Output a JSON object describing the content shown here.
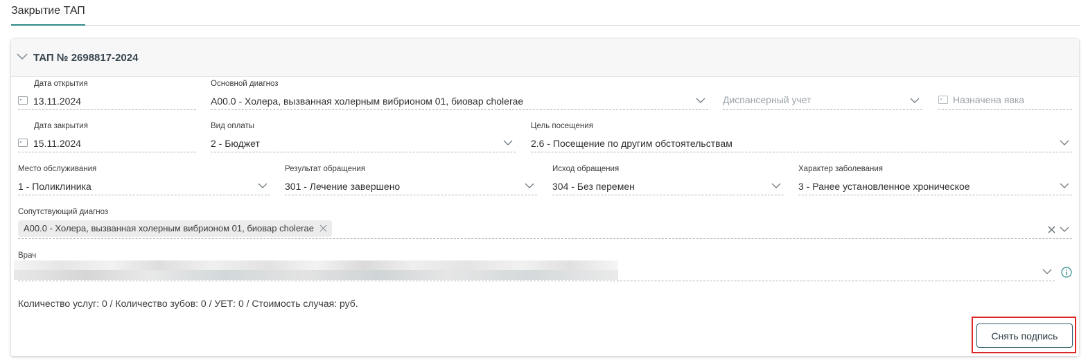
{
  "tabs": {
    "active": "Закрытие ТАП"
  },
  "card": {
    "title": "ТАП № 2698817-2024"
  },
  "fields": {
    "open_date": {
      "label": "Дата открытия",
      "value": "13.11.2024"
    },
    "main_diagnosis": {
      "label": "Основной диагноз",
      "value": "A00.0 - Холера, вызванная холерным вибрионом 01, биовар cholerae"
    },
    "dispensary": {
      "placeholder": "Диспансерный учет"
    },
    "appointment": {
      "placeholder": "Назначена явка"
    },
    "close_date": {
      "label": "Дата закрытия",
      "value": "15.11.2024"
    },
    "payment_type": {
      "label": "Вид оплаты",
      "value": "2 - Бюджет"
    },
    "visit_purpose": {
      "label": "Цель посещения",
      "value": "2.6 - Посещение по другим обстоятельствам"
    },
    "service_place": {
      "label": "Место обслуживания",
      "value": "1 - Поликлиника"
    },
    "appeal_result": {
      "label": "Результат обращения",
      "value": "301 - Лечение завершено"
    },
    "appeal_outcome": {
      "label": "Исход обращения",
      "value": "304 - Без перемен"
    },
    "disease_character": {
      "label": "Характер заболевания",
      "value": "3 - Ранее установленное хроническое"
    },
    "concomitant_diagnosis": {
      "label": "Сопутствующий диагноз",
      "chips": [
        "A00.0 - Холера, вызванная холерным вибрионом 01, биовар cholerae"
      ]
    },
    "doctor": {
      "label": "Врач"
    }
  },
  "summary": "Количество услуг: 0 / Количество зубов: 0 / УЕТ: 0 / Стоимость случая: руб.",
  "actions": {
    "remove_signature": "Снять подпись"
  },
  "colors": {
    "accent": "#2d8a86",
    "highlight": "#e02424",
    "info": "#2d8a86"
  },
  "icons": [
    "chevron-down-icon",
    "calendar-icon",
    "close-icon",
    "info-icon"
  ]
}
